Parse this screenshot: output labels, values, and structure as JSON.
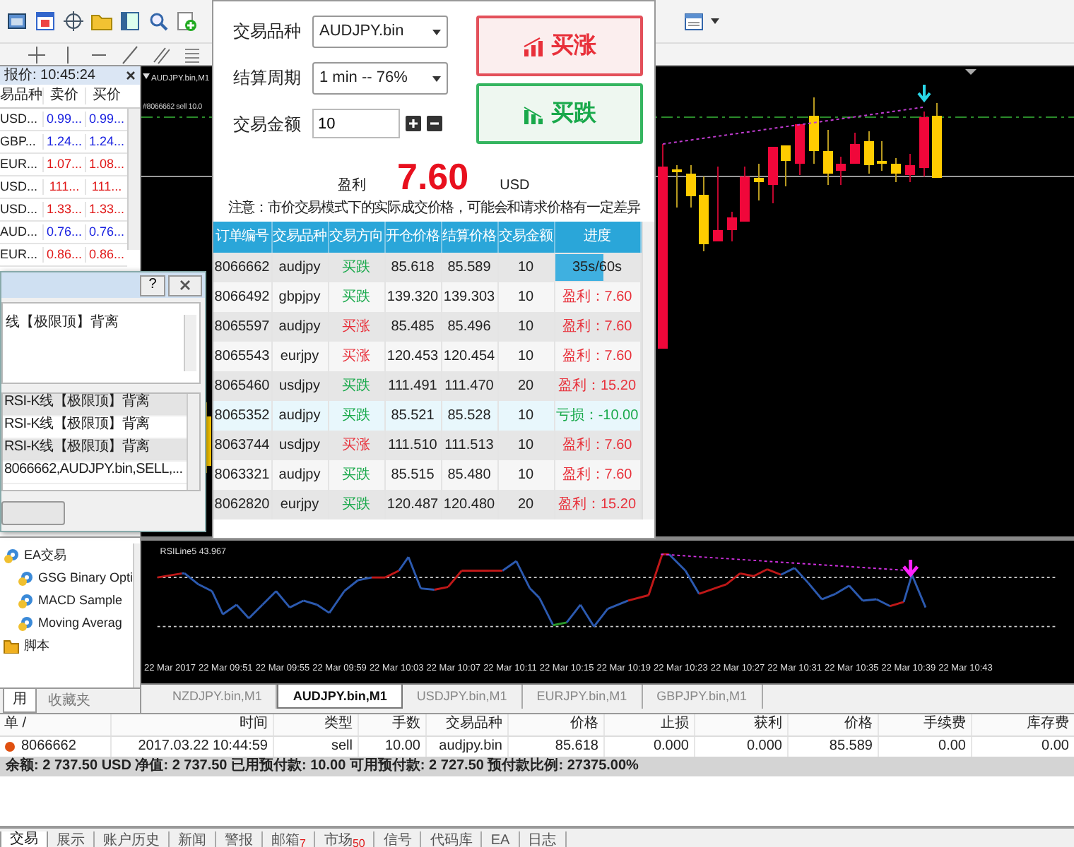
{
  "market_watch": {
    "title": "报价: 10:45:24",
    "columns": [
      "易品种",
      "卖价",
      "买价"
    ],
    "rows": [
      {
        "symbol": "USD...",
        "bid": "0.99...",
        "ask": "0.99...",
        "color": "#1a22e0"
      },
      {
        "symbol": "GBP...",
        "bid": "1.24...",
        "ask": "1.24...",
        "color": "#1a22e0"
      },
      {
        "symbol": "EUR...",
        "bid": "1.07...",
        "ask": "1.08...",
        "color": "#e01818"
      },
      {
        "symbol": "USD...",
        "bid": "111...",
        "ask": "111...",
        "color": "#e01818"
      },
      {
        "symbol": "USD...",
        "bid": "1.33...",
        "ask": "1.33...",
        "color": "#e01818"
      },
      {
        "symbol": "AUD...",
        "bid": "0.76...",
        "ask": "0.76...",
        "color": "#1a22e0"
      },
      {
        "symbol": "EUR...",
        "bid": "0.86...",
        "ask": "0.86...",
        "color": "#e01818"
      }
    ]
  },
  "alert_dialog": {
    "help": "?",
    "message": "线【极限顶】背离",
    "log": [
      {
        "text": "RSI-K线【极限顶】背离",
        "selected": true
      },
      {
        "text": "RSI-K线【极限顶】背离",
        "selected": false
      },
      {
        "text": "RSI-K线【极限顶】背离",
        "selected": true
      },
      {
        "text": "8066662,AUDJPY.bin,SELL,...",
        "selected": false
      }
    ]
  },
  "navigator": {
    "items": [
      {
        "label": "EA交易",
        "kind": "ea",
        "children": [
          {
            "label": "GSG Binary Opti",
            "kind": "ea"
          },
          {
            "label": "MACD Sample",
            "kind": "ea"
          },
          {
            "label": "Moving Averag",
            "kind": "ea"
          }
        ]
      },
      {
        "label": "脚本",
        "kind": "script"
      }
    ],
    "tabs": [
      {
        "label": "用",
        "selected": true
      },
      {
        "label": "收藏夹",
        "selected": false
      }
    ]
  },
  "chart": {
    "title": "AUDJPY.bin,M1",
    "order_label": "#8066662 sell 10.0",
    "indicator_label": "RSILine5 43.967",
    "time_labels": [
      "22 Mar 2017",
      "22 Mar 09:51",
      "22 Mar 09:55",
      "22 Mar 09:59",
      "22 Mar 10:03",
      "22 Mar 10:07",
      "22 Mar 10:11",
      "22 Mar 10:15",
      "22 Mar 10:19",
      "22 Mar 10:23",
      "22 Mar 10:27",
      "22 Mar 10:31",
      "22 Mar 10:35",
      "22 Mar 10:39",
      "22 Mar 10:43"
    ]
  },
  "chart_tabs": [
    {
      "label": "NZDJPY.bin,M1",
      "selected": false
    },
    {
      "label": "AUDJPY.bin,M1",
      "selected": true
    },
    {
      "label": "USDJPY.bin,M1",
      "selected": false
    },
    {
      "label": "EURJPY.bin,M1",
      "selected": false
    },
    {
      "label": "GBPJPY.bin,M1",
      "selected": false
    }
  ],
  "trade_panel": {
    "symbol_label": "交易品种",
    "symbol": "AUDJPY.bin",
    "period_label": "结算周期",
    "period": "1 min -- 76%",
    "amount_label": "交易金额",
    "amount": "10",
    "buy_up": "买涨",
    "buy_down": "买跌",
    "profit_label": "盈利",
    "profit": "7.60",
    "currency": "USD",
    "notice": "注意：市价交易模式下的实际成交价格，可能会和请求价格有一定差异",
    "columns": [
      "订单编号",
      "交易品种",
      "交易方向",
      "开仓价格",
      "结算价格",
      "交易金额",
      "进度"
    ],
    "orders": [
      {
        "id": "8066662",
        "symbol": "audjpy",
        "direction": "买跌",
        "color": "#19a94b",
        "open": "85.618",
        "settle": "85.589",
        "amount": "10",
        "kind": "progress",
        "result": "35s/60s",
        "level": 0.58,
        "selected": false
      },
      {
        "id": "8066492",
        "symbol": "gbpjpy",
        "direction": "买跌",
        "color": "#19a94b",
        "open": "139.320",
        "settle": "139.303",
        "amount": "10",
        "kind": "profit",
        "result": "盈利：7.60",
        "selected": false
      },
      {
        "id": "8065597",
        "symbol": "audjpy",
        "direction": "买涨",
        "color": "#e8303a",
        "open": "85.485",
        "settle": "85.496",
        "amount": "10",
        "kind": "profit",
        "result": "盈利：7.60",
        "selected": false
      },
      {
        "id": "8065543",
        "symbol": "eurjpy",
        "direction": "买涨",
        "color": "#e8303a",
        "open": "120.453",
        "settle": "120.454",
        "amount": "10",
        "kind": "profit",
        "result": "盈利：7.60",
        "selected": false
      },
      {
        "id": "8065460",
        "symbol": "usdjpy",
        "direction": "买跌",
        "color": "#19a94b",
        "open": "111.491",
        "settle": "111.470",
        "amount": "20",
        "kind": "profit",
        "result": "盈利：15.20",
        "selected": false
      },
      {
        "id": "8065352",
        "symbol": "audjpy",
        "direction": "买跌",
        "color": "#19a94b",
        "open": "85.521",
        "settle": "85.528",
        "amount": "10",
        "kind": "loss",
        "result": "亏损：-10.00",
        "selected": true
      },
      {
        "id": "8063744",
        "symbol": "usdjpy",
        "direction": "买涨",
        "color": "#e8303a",
        "open": "111.510",
        "settle": "111.513",
        "amount": "10",
        "kind": "profit",
        "result": "盈利：7.60",
        "selected": false
      },
      {
        "id": "8063321",
        "symbol": "audjpy",
        "direction": "买跌",
        "color": "#19a94b",
        "open": "85.515",
        "settle": "85.480",
        "amount": "10",
        "kind": "profit",
        "result": "盈利：7.60",
        "selected": false
      },
      {
        "id": "8062820",
        "symbol": "eurjpy",
        "direction": "买跌",
        "color": "#19a94b",
        "open": "120.487",
        "settle": "120.480",
        "amount": "20",
        "kind": "profit",
        "result": "盈利：15.20",
        "selected": false
      }
    ]
  },
  "terminal": {
    "columns": [
      "单 /",
      "时间",
      "类型",
      "手数",
      "交易品种",
      "价格",
      "止损",
      "获利",
      "价格",
      "手续费",
      "库存费"
    ],
    "rows": [
      {
        "cells": [
          "8066662",
          "2017.03.22 10:44:59",
          "sell",
          "10.00",
          "audjpy.bin",
          "85.618",
          "0.000",
          "0.000",
          "85.589",
          "0.00",
          "0.00"
        ]
      }
    ],
    "balance": "余额: 2 737.50 USD 净值: 2 737.50 已用预付款: 10.00 可用预付款: 2 727.50 预付款比例: 27375.00%"
  },
  "bottom_tabs": [
    {
      "label": "交易",
      "selected": true
    },
    {
      "label": "展示",
      "selected": false
    },
    {
      "label": "账户历史",
      "selected": false
    },
    {
      "label": "新闻",
      "selected": false
    },
    {
      "label": "警报",
      "selected": false
    },
    {
      "label": "邮箱",
      "count": "7",
      "selected": false
    },
    {
      "label": "市场",
      "count": "50",
      "selected": false
    },
    {
      "label": "信号",
      "selected": false
    },
    {
      "label": "代码库",
      "selected": false
    },
    {
      "label": "EA",
      "selected": false
    },
    {
      "label": "日志",
      "selected": false
    }
  ]
}
